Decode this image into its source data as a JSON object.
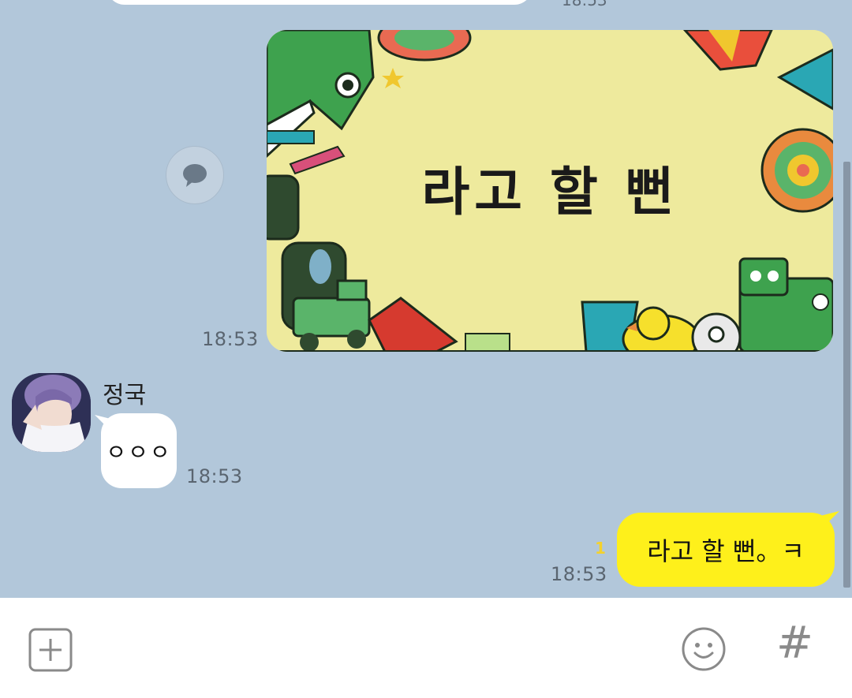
{
  "chat": {
    "previous_time": "18:53",
    "image_message": {
      "caption": "라고 할 뻔",
      "time": "18:53"
    },
    "incoming": {
      "sender": "정국",
      "text": "ㅇㅇㅇ",
      "time": "18:53"
    },
    "outgoing": {
      "text": "라고 할 뻔。ㅋ",
      "time": "18:53",
      "unread_count": "1"
    }
  },
  "input_bar": {
    "plus_icon": "plus-box-icon",
    "emoji_icon": "smile-icon",
    "hash_label": "#"
  },
  "colors": {
    "background": "#b2c7da",
    "outgoing_bubble": "#fef01b",
    "incoming_bubble": "#ffffff",
    "unread": "#f4d22c"
  }
}
